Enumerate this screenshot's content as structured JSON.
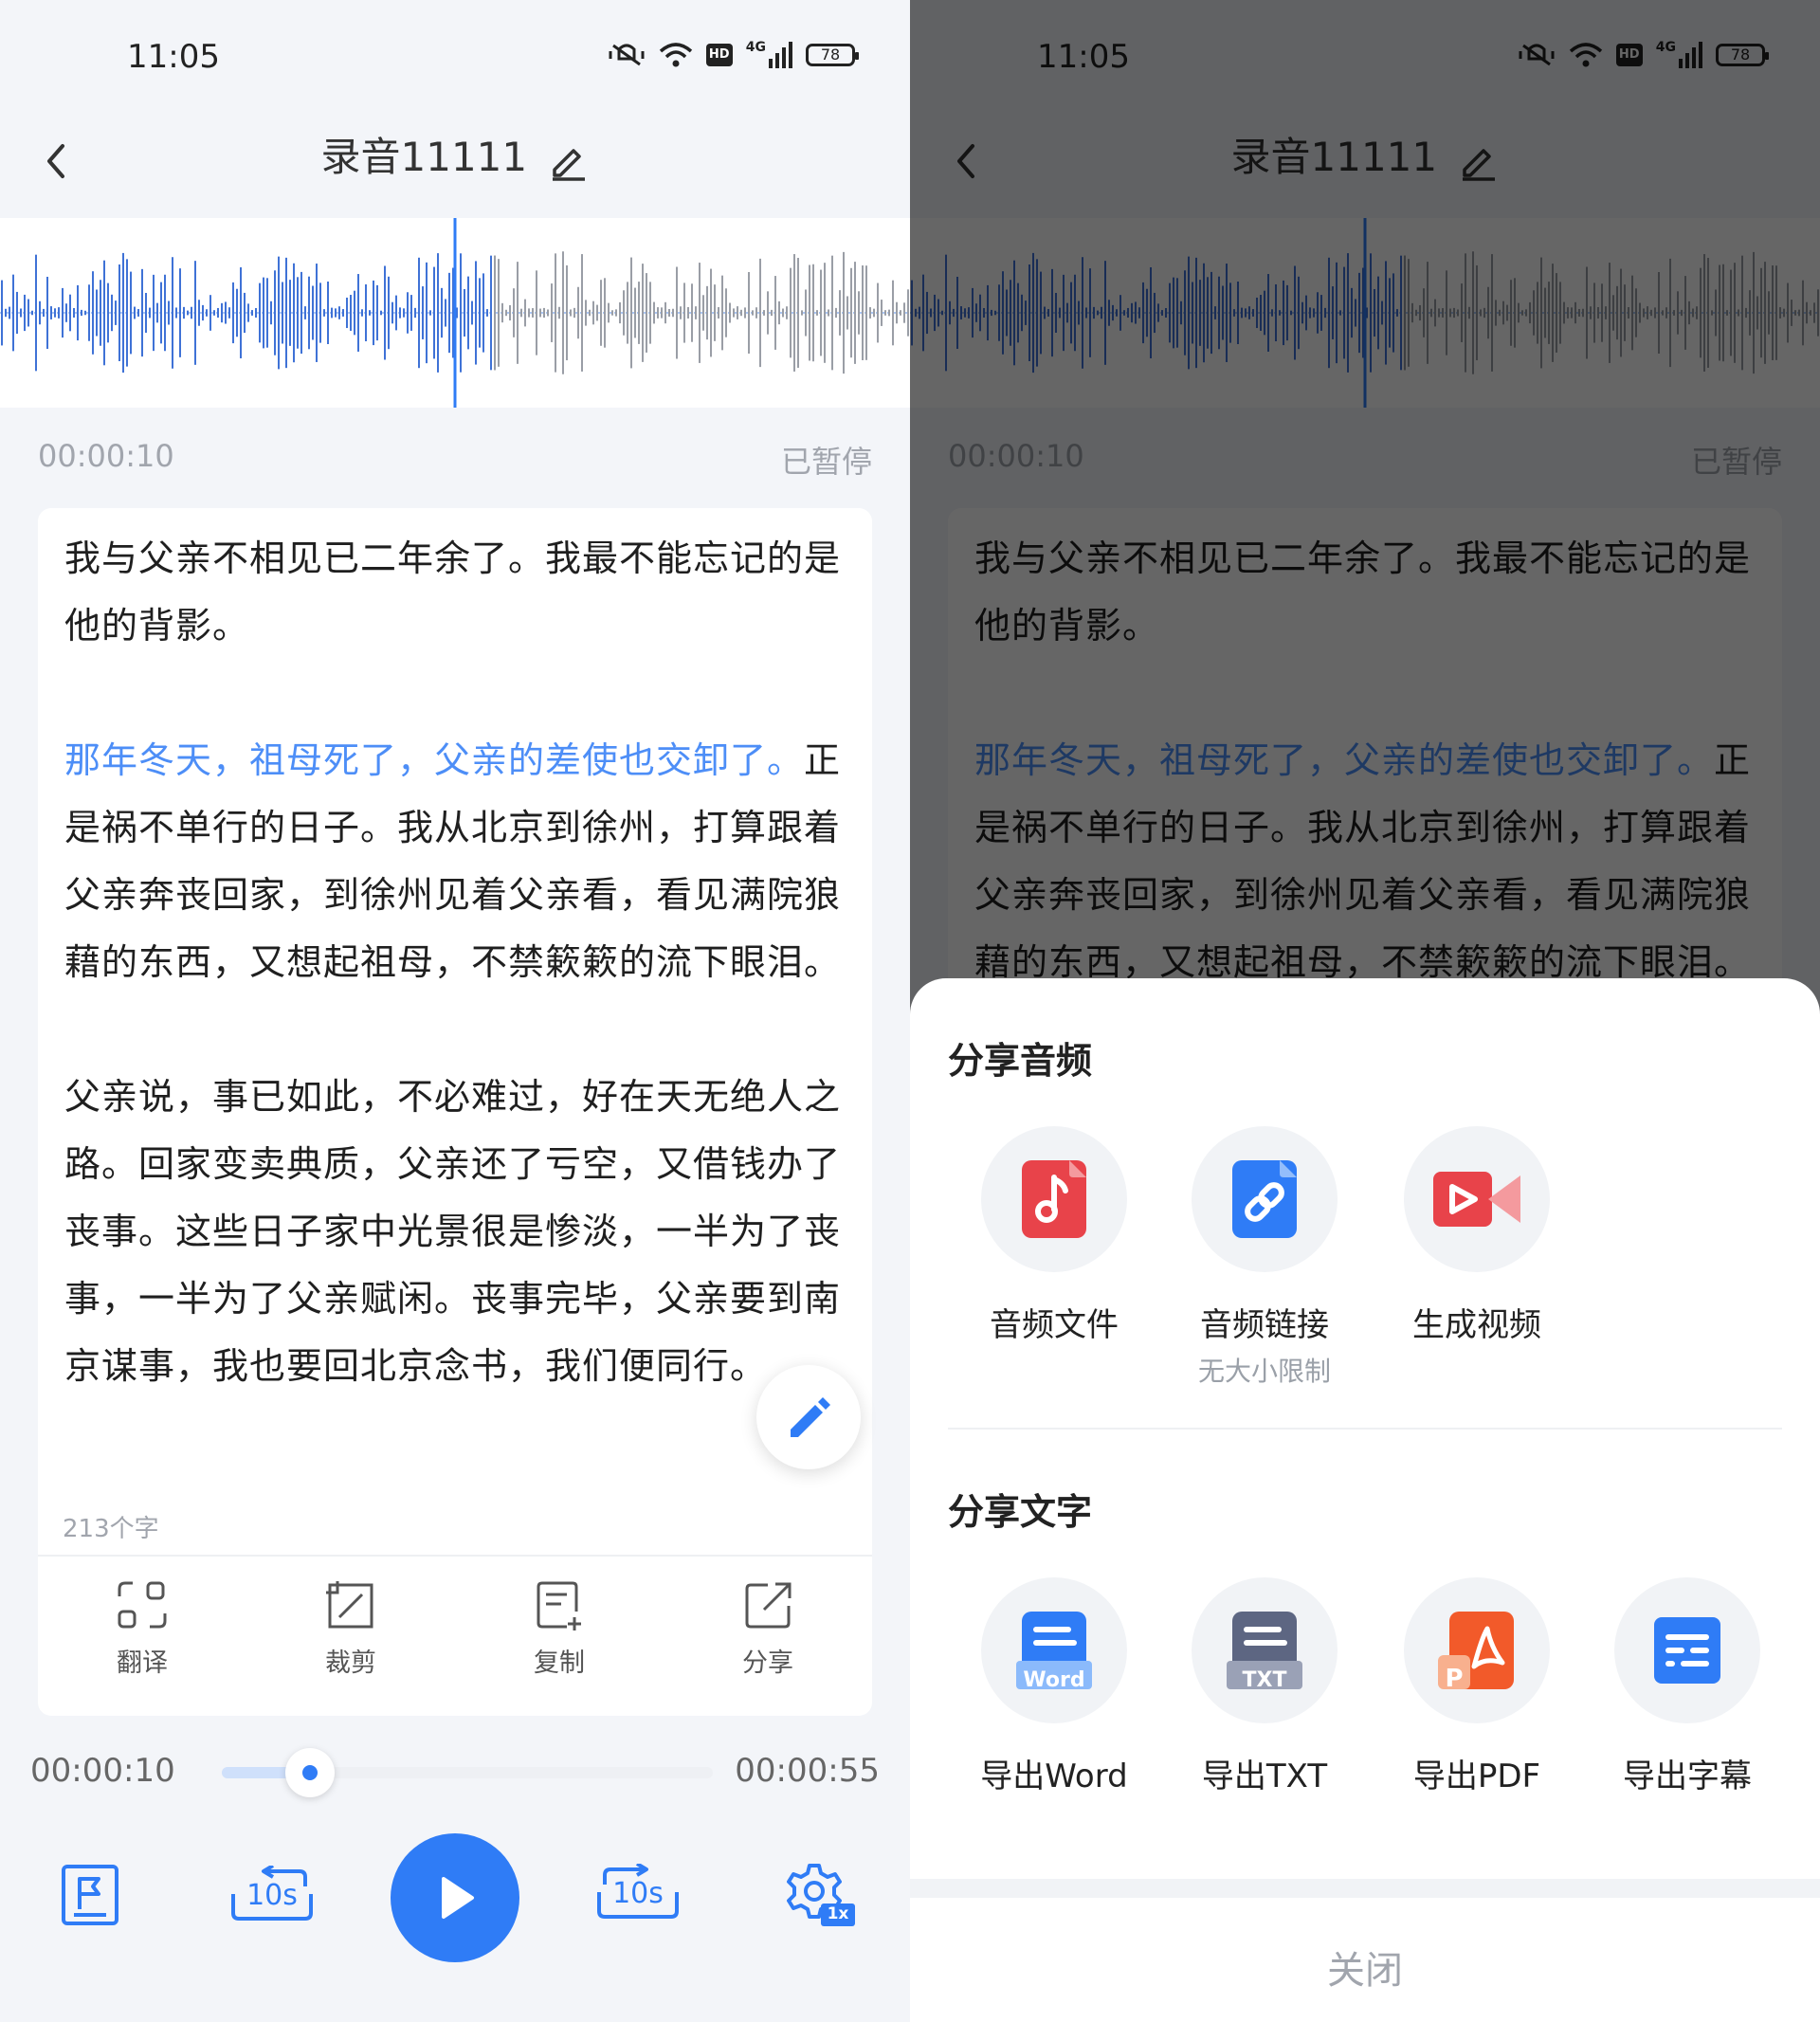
{
  "status_bar": {
    "time": "11:05",
    "battery": "78",
    "hd": "HD",
    "network": "4G"
  },
  "header": {
    "title": "录音11111"
  },
  "player": {
    "current_time": "00:00:10",
    "state": "已暂停",
    "elapsed": "00:00:10",
    "total": "00:00:55",
    "progress": 0.18,
    "skip_back_label": "10s",
    "skip_forward_label": "10s",
    "speed": "1x"
  },
  "transcript": {
    "p1": "我与父亲不相见已二年余了。我最不能忘记的是他的背影。",
    "p2_highlight": "那年冬天，祖母死了，父亲的差使也交卸了。",
    "p2_rest": "正是祸不单行的日子。我从北京到徐州，打算跟着父亲奔丧回家，到徐州见着父亲看，看见满院狼藉的东西，又想起祖母，不禁簌簌的流下眼泪。",
    "p3": "父亲说，事已如此，不必难过，好在天无绝人之路。回家变卖典质，父亲还了亏空，又借钱办了丧事。这些日子家中光景很是惨淡，一半为了丧事，一半为了父亲赋闲。丧事完毕，父亲要到南京谋事，我也要回北京念书，我们便同行。",
    "char_count": "213个字"
  },
  "toolbar": {
    "translate": "翻译",
    "crop": "裁剪",
    "copy": "复制",
    "share": "分享"
  },
  "share_sheet": {
    "audio_title": "分享音频",
    "audio_file": "音频文件",
    "audio_link": "音频链接",
    "audio_link_sub": "无大小限制",
    "gen_video": "生成视频",
    "text_title": "分享文字",
    "export_word": "导出Word",
    "export_txt": "导出TXT",
    "export_pdf": "导出PDF",
    "export_subtitle": "导出字幕",
    "word_badge": "Word",
    "txt_badge": "TXT",
    "pdf_badge": "P",
    "close": "关闭"
  },
  "colors": {
    "accent": "#2f7cf6",
    "highlight_text": "#4d8ef7",
    "overlay": "rgba(0,0,0,0.6)"
  },
  "icons": [
    "back-icon",
    "edit-icon",
    "translate-icon",
    "crop-icon",
    "copy-icon",
    "share-icon",
    "bookmark-icon",
    "rewind-icon",
    "play-icon",
    "forward-icon",
    "settings-icon"
  ]
}
